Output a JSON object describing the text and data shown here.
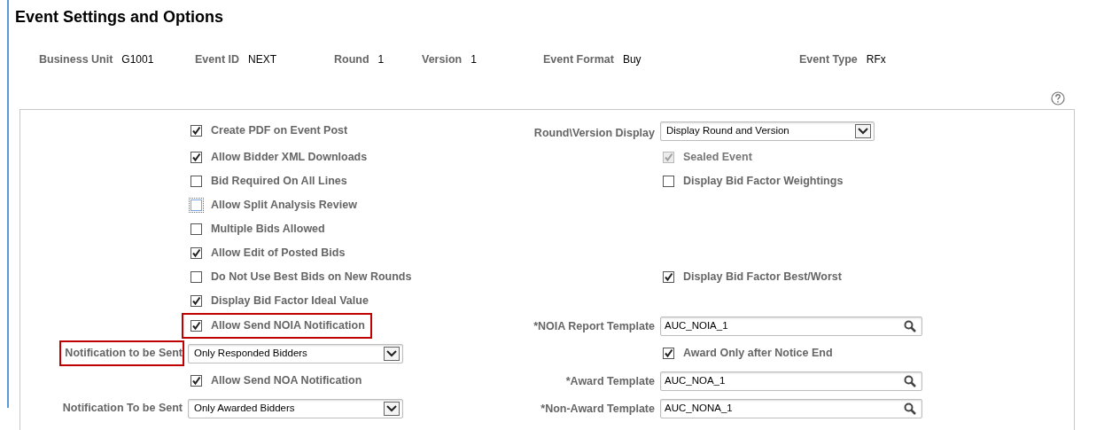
{
  "title": "Event Settings and Options",
  "header_fields": [
    {
      "label": "Business Unit",
      "value": "G1001"
    },
    {
      "label": "Event ID",
      "value": "NEXT"
    },
    {
      "label": "Round",
      "value": "1"
    },
    {
      "label": "Version",
      "value": "1"
    },
    {
      "label": "Event Format",
      "value": "Buy"
    },
    {
      "label": "Event Type",
      "value": "RFx"
    }
  ],
  "rows": [
    {
      "left": {
        "kind": "checkbox",
        "label": "Create PDF on Event Post",
        "checked": true
      },
      "right": {
        "kind": "select",
        "label": "Round\\Version Display",
        "value": "Display Round and Version"
      }
    },
    {
      "left": {
        "kind": "checkbox",
        "label": "Allow Bidder XML Downloads",
        "checked": true
      },
      "right": {
        "kind": "checkbox",
        "label": "Sealed Event",
        "checked": true,
        "disabled": true
      }
    },
    {
      "left": {
        "kind": "checkbox",
        "label": "Bid Required On All Lines",
        "checked": false
      },
      "right": {
        "kind": "checkbox",
        "label": "Display Bid Factor Weightings",
        "checked": false
      }
    },
    {
      "left": {
        "kind": "checkbox",
        "label": "Allow Split Analysis Review",
        "checked": false,
        "focused": true
      }
    },
    {
      "left": {
        "kind": "checkbox",
        "label": "Multiple Bids Allowed",
        "checked": false
      }
    },
    {
      "left": {
        "kind": "checkbox",
        "label": "Allow Edit of Posted Bids",
        "checked": true
      }
    },
    {
      "left": {
        "kind": "checkbox",
        "label": "Do Not Use Best Bids on New Rounds",
        "checked": false
      },
      "right": {
        "kind": "checkbox",
        "label": "Display Bid Factor Best/Worst",
        "checked": true
      }
    },
    {
      "left": {
        "kind": "checkbox",
        "label": "Display Bid Factor Ideal Value",
        "checked": true
      }
    },
    {
      "left": {
        "kind": "checkbox",
        "label": "Allow Send NOIA Notification",
        "checked": true,
        "highlighted": true
      },
      "right": {
        "kind": "lookup",
        "label": "*NOIA Report Template",
        "value": "AUC_NOIA_1"
      }
    },
    {
      "left": {
        "kind": "select",
        "label": "Notification to be Sent",
        "value": "Only Responded Bidders",
        "highlighted": true
      },
      "right": {
        "kind": "checkbox",
        "label": "Award Only after Notice End",
        "checked": true
      }
    },
    {
      "left": {
        "kind": "checkbox",
        "label": "Allow Send NOA Notification",
        "checked": true
      },
      "right": {
        "kind": "lookup",
        "label": "*Award Template",
        "value": "AUC_NOA_1"
      }
    },
    {
      "left": {
        "kind": "select",
        "label": "Notification To be Sent",
        "value": "Only Awarded Bidders"
      },
      "right": {
        "kind": "lookup",
        "label": "*Non-Award Template",
        "value": "AUC_NONA_1"
      }
    }
  ]
}
